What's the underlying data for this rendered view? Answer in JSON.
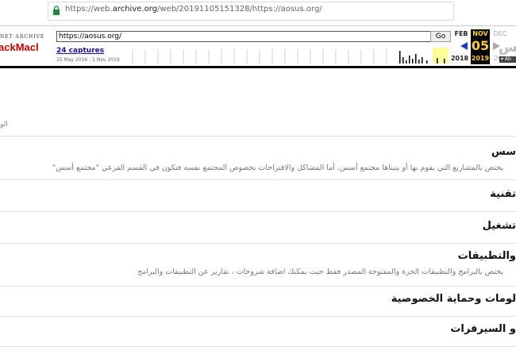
{
  "browser": {
    "url_prefix": "https://web.",
    "url_domain": "archive.org",
    "url_suffix": "/web/20191105151328/https://aosus.org/"
  },
  "wayback": {
    "logo_top": "NET ARCHIVE",
    "logo_main": "ackMachine",
    "url_value": "https://aosus.org/",
    "go_label": "Go",
    "captures": "24 captures",
    "daterange": "25 May 2016 - 5 Nov 2019",
    "prev_month": "FEB",
    "prev_year": "2018",
    "cur_month": "NOV",
    "cur_day": "05",
    "cur_year": "2019",
    "next_month": "DEC",
    "next_year": "20",
    "ghost": "سس",
    "about_label": "Ab",
    "accent": "#ffcc33"
  },
  "page": {
    "partial_left": "الو",
    "forums": [
      {
        "title": "سس",
        "desc": "يختص بالمشاريع التي يقوم بها أو يتبناها مجتمع أسس. أما المشاكل والاقتراحات بخصوص المجتمع نفسه فتكون في القسم الفرعي \"مجتمع أسس\""
      },
      {
        "title": "تقنية",
        "desc": ""
      },
      {
        "title": "تشغيل",
        "desc": ""
      },
      {
        "title": "والتطبيقات",
        "desc": "يختص بالبرامج والتطبيقات الحرة والمفتوحة المصدر فقط حيث يمكنك اضافة شروحات ، تقارير عن التطبيقات والبرامج"
      },
      {
        "title": "لومات وحماية الخصوصية",
        "desc": ""
      },
      {
        "title": "و السيرفرات",
        "desc": ""
      },
      {
        "title": "",
        "desc": ""
      }
    ]
  }
}
